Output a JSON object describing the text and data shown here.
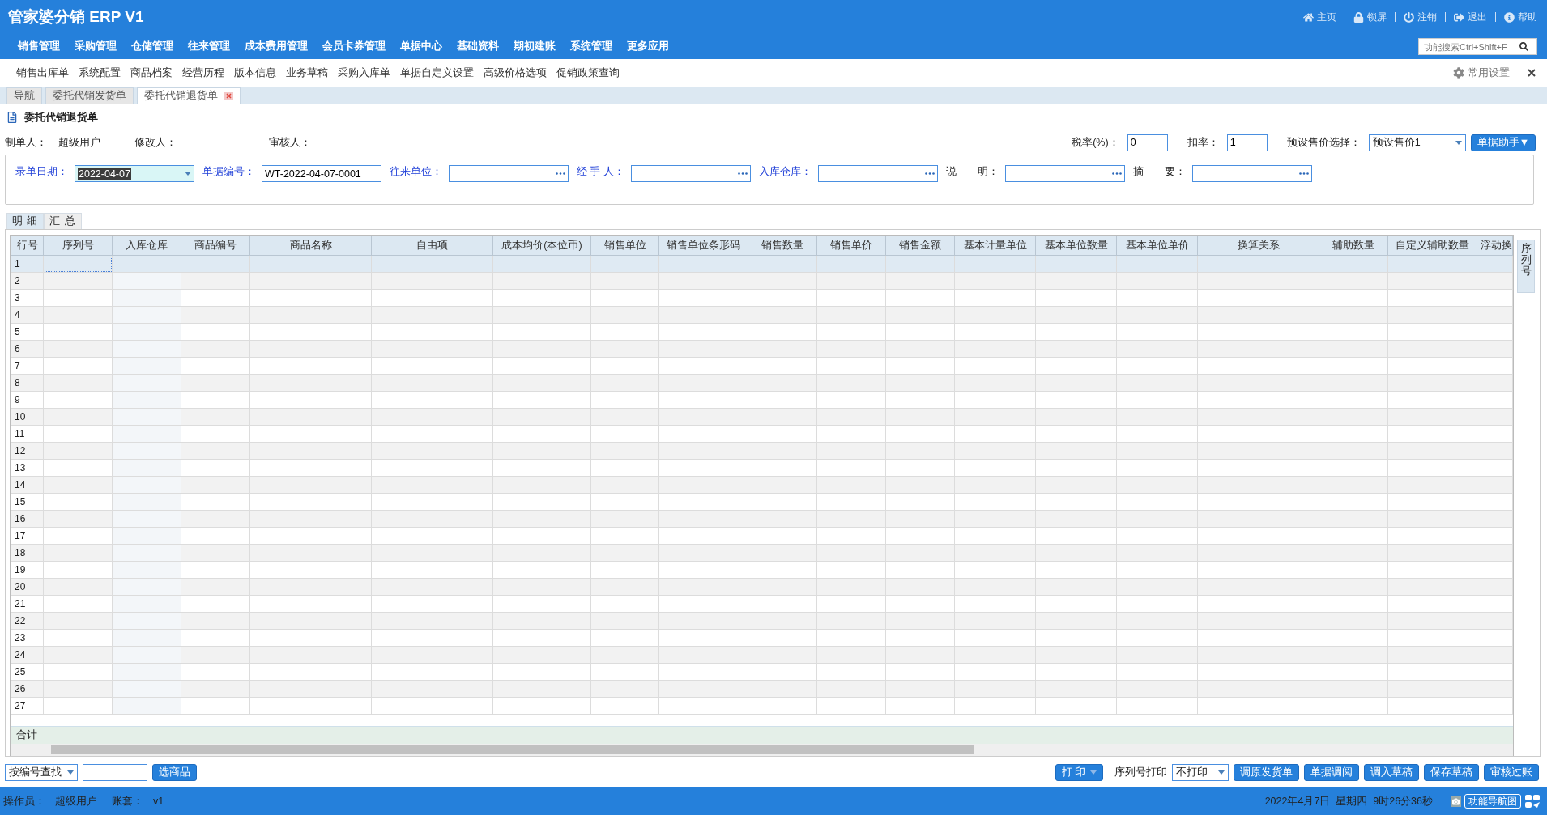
{
  "app_title": "管家婆分销 ERP V1",
  "top_links": [
    {
      "kind": "home",
      "label": "主页"
    },
    {
      "kind": "lock",
      "label": "锁屏"
    },
    {
      "kind": "power",
      "label": "注销"
    },
    {
      "kind": "exit",
      "label": "退出"
    },
    {
      "kind": "info",
      "label": "帮助"
    }
  ],
  "menu": [
    "销售管理",
    "采购管理",
    "仓储管理",
    "往来管理",
    "成本费用管理",
    "会员卡券管理",
    "单据中心",
    "基础资料",
    "期初建账",
    "系统管理",
    "更多应用"
  ],
  "search": {
    "placeholder": "功能搜索Ctrl+Shift+F"
  },
  "shortcuts": [
    "销售出库单",
    "系统配置",
    "商品档案",
    "经营历程",
    "版本信息",
    "业务草稿",
    "采购入库单",
    "单据自定义设置",
    "高级价格选项",
    "促销政策查询"
  ],
  "settings_label": "常用设置",
  "doc_tabs": [
    {
      "label": "导航",
      "selected": false,
      "closable": false
    },
    {
      "label": "委托代销发货单",
      "selected": false,
      "closable": false
    },
    {
      "label": "委托代销退货单",
      "selected": true,
      "closable": true
    }
  ],
  "page_title": "委托代销退货单",
  "people": [
    {
      "label": "制单人：",
      "value": "超级用户"
    },
    {
      "label": "修改人："
    },
    {
      "label": "审核人："
    }
  ],
  "rates": [
    {
      "label": "税率(%)：",
      "value": "0"
    },
    {
      "label": "扣率：",
      "value": "1"
    }
  ],
  "price_select": {
    "label": "预设售价选择：",
    "value": "预设售价1"
  },
  "helper_button": "单据助手▼",
  "fields": [
    {
      "kind": "date",
      "label": "录单日期：",
      "required": true,
      "value": "2022-04-07"
    },
    {
      "kind": "text",
      "label": "单据编号：",
      "required": true,
      "value": "WT-2022-04-07-0001"
    },
    {
      "kind": "lookup",
      "label": "往来单位：",
      "required": true
    },
    {
      "kind": "lookup",
      "label": "经 手 人：",
      "required": true
    },
    {
      "kind": "lookup",
      "label": "入库仓库：",
      "required": true
    },
    {
      "kind": "lookup",
      "label": "说　　明：",
      "required": false
    },
    {
      "kind": "lookup",
      "label": "摘　　要：",
      "required": false
    }
  ],
  "grid_tabs": [
    {
      "label": "明 细",
      "selected": true
    },
    {
      "label": "汇 总",
      "selected": false
    }
  ],
  "table": {
    "columns": [
      "行号",
      "序列号",
      "入库仓库",
      "商品编号",
      "商品名称",
      "自由项",
      "成本均价(本位币)",
      "销售单位",
      "销售单位条形码",
      "销售数量",
      "销售单价",
      "销售金额",
      "基本计量单位",
      "基本单位数量",
      "基本单位单价",
      "换算关系",
      "辅助数量",
      "自定义辅助数量",
      "浮动换"
    ],
    "rows": [
      {
        "number": "1",
        "selected": true
      },
      {
        "number": "2",
        "selected": false
      },
      {
        "number": "3",
        "selected": false
      },
      {
        "number": "4",
        "selected": false
      },
      {
        "number": "5",
        "selected": false
      },
      {
        "number": "6",
        "selected": false
      },
      {
        "number": "7",
        "selected": false
      },
      {
        "number": "8",
        "selected": false
      },
      {
        "number": "9",
        "selected": false
      },
      {
        "number": "10",
        "selected": false
      },
      {
        "number": "11",
        "selected": false
      },
      {
        "number": "12",
        "selected": false
      },
      {
        "number": "13",
        "selected": false
      },
      {
        "number": "14",
        "selected": false
      },
      {
        "number": "15",
        "selected": false
      },
      {
        "number": "16",
        "selected": false
      },
      {
        "number": "17",
        "selected": false
      },
      {
        "number": "18",
        "selected": false
      },
      {
        "number": "19",
        "selected": false
      },
      {
        "number": "20",
        "selected": false
      },
      {
        "number": "21",
        "selected": false
      },
      {
        "number": "22",
        "selected": false
      },
      {
        "number": "23",
        "selected": false
      },
      {
        "number": "24",
        "selected": false
      },
      {
        "number": "25",
        "selected": false
      },
      {
        "number": "26",
        "selected": false
      },
      {
        "number": "27",
        "selected": false
      }
    ],
    "total_label": "合计"
  },
  "side_tab": "序列号",
  "find": {
    "mode": "按编号查找",
    "button": "选商品"
  },
  "print_button": "打 印",
  "serial_print": {
    "label": "序列号打印",
    "value": "不打印"
  },
  "actions": [
    "调原发货单",
    "单据调阅",
    "调入草稿",
    "保存草稿",
    "审核过账"
  ],
  "status": [
    {
      "label": "操作员：",
      "value": "超级用户"
    },
    {
      "label": "账套：",
      "value": "v1"
    }
  ],
  "datetime": "2022年4月7日  星期四  9时26分36秒",
  "nav_button": "功能导航图"
}
